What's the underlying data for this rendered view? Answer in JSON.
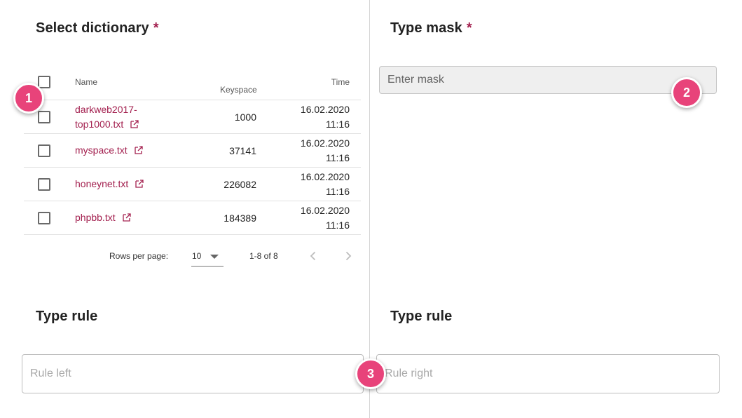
{
  "left_section": {
    "title": "Select dictionary",
    "required_mark": "*"
  },
  "table": {
    "headers": {
      "name": "Name",
      "keyspace": "Keyspace",
      "time": "Time"
    },
    "rows": [
      {
        "name_line1": "darkweb2017-",
        "name_line2": "top1000.txt",
        "keyspace": "1000",
        "date": "16.02.2020",
        "clock": "11:16"
      },
      {
        "name": "myspace.txt",
        "keyspace": "37141",
        "date": "16.02.2020",
        "clock": "11:16"
      },
      {
        "name": "honeynet.txt",
        "keyspace": "226082",
        "date": "16.02.2020",
        "clock": "11:16"
      },
      {
        "name": "phpbb.txt",
        "keyspace": "184389",
        "date": "16.02.2020",
        "clock": "11:16"
      }
    ]
  },
  "pagination": {
    "rows_per_page_label": "Rows per page:",
    "rows_per_page_value": "10",
    "range": "1-8 of 8"
  },
  "right_section": {
    "title": "Type mask",
    "required_mark": "*",
    "mask_placeholder": "Enter mask"
  },
  "rules": {
    "left_title": "Type rule",
    "right_title": "Type rule",
    "left_placeholder": "Rule left",
    "right_placeholder": "Rule right"
  },
  "badges": [
    "1",
    "2",
    "3"
  ],
  "colors": {
    "accent": "#a3204f",
    "badge": "#e8437a",
    "divider": "#d4d4d4"
  },
  "icons": [
    "external-link-icon",
    "checkbox-icon",
    "caret-down-icon",
    "chevron-left-icon",
    "chevron-right-icon"
  ]
}
